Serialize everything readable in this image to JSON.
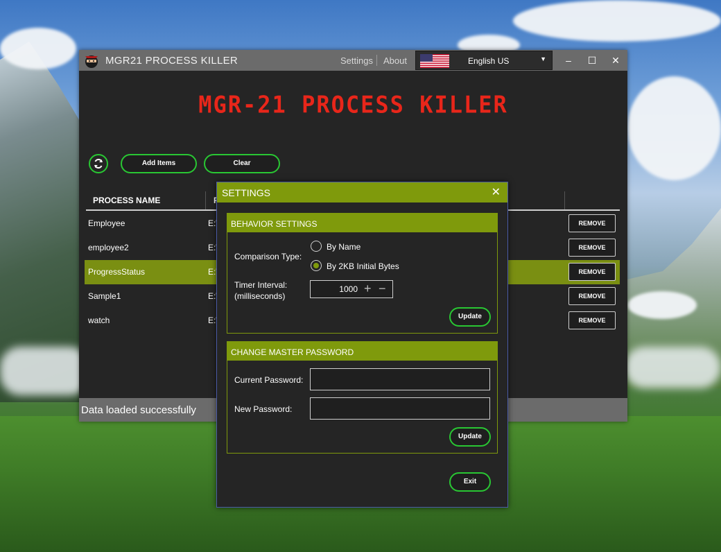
{
  "window": {
    "title": "MGR21 PROCESS KILLER",
    "menu": {
      "settings": "Settings",
      "about": "About"
    },
    "language": "English US",
    "controls": {
      "minimize": "–",
      "maximize": "☐",
      "close": "✕"
    }
  },
  "banner": "MGR-21 PROCESS KILLER",
  "toolbar": {
    "add_items": "Add Items",
    "clear": "Clear"
  },
  "table": {
    "headers": [
      "PROCESS NAME",
      "F"
    ],
    "rows": [
      {
        "name": "Employee",
        "path": "E:\\",
        "action": "REMOVE"
      },
      {
        "name": "employee2",
        "path": "E:\\",
        "action": "REMOVE"
      },
      {
        "name": "ProgressStatus",
        "path": "E:\\",
        "action": "REMOVE"
      },
      {
        "name": "Sample1",
        "path": "E:\\",
        "action": "REMOVE"
      },
      {
        "name": "watch",
        "path": "E:\\",
        "action": "REMOVE"
      }
    ]
  },
  "status": "Data loaded successfully",
  "settings_dialog": {
    "title": "SETTINGS",
    "close": "✕",
    "behavior": {
      "header": "BEHAVIOR SETTINGS",
      "comparison_label": "Comparison Type:",
      "option_name": "By Name",
      "option_bytes": "By 2KB Initial Bytes",
      "selected_option": "By 2KB Initial Bytes",
      "timer_label_1": "Timer Interval:",
      "timer_label_2": "(milliseconds)",
      "timer_value": "1000",
      "update": "Update"
    },
    "password": {
      "header": "CHANGE MASTER PASSWORD",
      "current_label": "Current Password:",
      "new_label": "New Password:",
      "current_value": "",
      "new_value": "",
      "update": "Update"
    },
    "exit": "Exit"
  },
  "colors": {
    "accent_green": "#7f9a0c",
    "button_outline": "#29c733",
    "title_red": "#e8261a"
  }
}
